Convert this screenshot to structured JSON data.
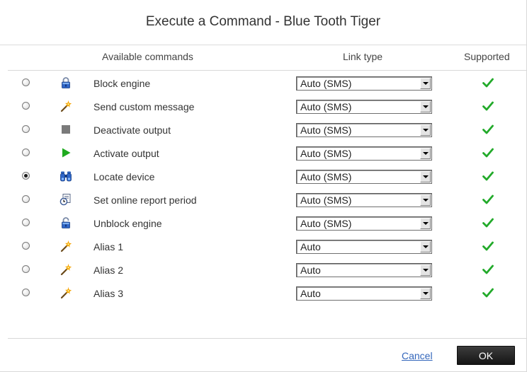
{
  "dialog": {
    "title": "Execute a Command - Blue Tooth Tiger"
  },
  "table": {
    "headers": {
      "commands": "Available commands",
      "link_type": "Link type",
      "supported": "Supported"
    },
    "rows": [
      {
        "label": "Block engine",
        "icon": "lock-icon",
        "link_type": "Auto (SMS)",
        "selected": false,
        "supported": true
      },
      {
        "label": "Send custom message",
        "icon": "magic-wand-icon",
        "link_type": "Auto (SMS)",
        "selected": false,
        "supported": true
      },
      {
        "label": "Deactivate output",
        "icon": "stop-square-icon",
        "link_type": "Auto (SMS)",
        "selected": false,
        "supported": true
      },
      {
        "label": "Activate output",
        "icon": "play-triangle-icon",
        "link_type": "Auto (SMS)",
        "selected": false,
        "supported": true
      },
      {
        "label": "Locate device",
        "icon": "binoculars-icon",
        "link_type": "Auto (SMS)",
        "selected": true,
        "supported": true
      },
      {
        "label": "Set online report period",
        "icon": "report-period-icon",
        "link_type": "Auto (SMS)",
        "selected": false,
        "supported": true
      },
      {
        "label": "Unblock engine",
        "icon": "unlock-icon",
        "link_type": "Auto (SMS)",
        "selected": false,
        "supported": true
      },
      {
        "label": "Alias 1",
        "icon": "magic-wand-icon",
        "link_type": "Auto",
        "selected": false,
        "supported": true
      },
      {
        "label": "Alias 2",
        "icon": "magic-wand-icon",
        "link_type": "Auto",
        "selected": false,
        "supported": true
      },
      {
        "label": "Alias 3",
        "icon": "magic-wand-icon",
        "link_type": "Auto",
        "selected": false,
        "supported": true
      }
    ]
  },
  "footer": {
    "cancel_label": "Cancel",
    "ok_label": "OK"
  },
  "colors": {
    "check_green": "#22aa2a",
    "play_green": "#1faa1f",
    "link_blue": "#3366bb",
    "ok_button_bg": "#1e1e1e"
  }
}
